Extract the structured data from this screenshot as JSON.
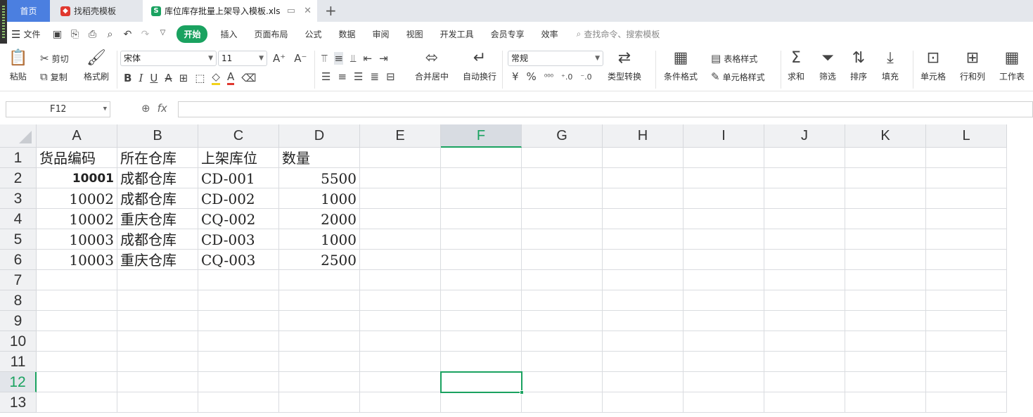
{
  "tabs": {
    "home": "首页",
    "template": "找稻壳模板",
    "file": "库位库存批量上架导入模板.xls"
  },
  "menu": {
    "file_label": "文件",
    "items": [
      "开始",
      "插入",
      "页面布局",
      "公式",
      "数据",
      "审阅",
      "视图",
      "开发工具",
      "会员专享",
      "效率"
    ],
    "search_placeholder": "查找命令、搜索模板"
  },
  "ribbon": {
    "paste": "粘贴",
    "cut": "剪切",
    "copy": "复制",
    "format_painter": "格式刷",
    "font_name": "宋体",
    "font_size": "11",
    "merge_center": "合并居中",
    "wrap_text": "自动换行",
    "number_format": "常规",
    "type_convert": "类型转换",
    "cond_format": "条件格式",
    "table_style": "表格样式",
    "cell_style": "单元格样式",
    "sum": "求和",
    "filter": "筛选",
    "sort": "排序",
    "fill": "填充",
    "cell": "单元格",
    "row_col": "行和列",
    "worksheet": "工作表",
    "currency_symbol": "¥",
    "percent_symbol": "%"
  },
  "formula_bar": {
    "cell_ref": "F12",
    "fx": "fx",
    "content": ""
  },
  "sheet": {
    "columns": [
      "A",
      "B",
      "C",
      "D",
      "E",
      "F",
      "G",
      "H",
      "I",
      "J",
      "K",
      "L"
    ],
    "rows": [
      "1",
      "2",
      "3",
      "4",
      "5",
      "6",
      "7",
      "8",
      "9",
      "10",
      "11",
      "12",
      "13"
    ],
    "selected_cell": "F12",
    "data": [
      [
        "货品编码",
        "所在仓库",
        "上架库位",
        "数量"
      ],
      [
        "10001",
        "成都仓库",
        "CD-001",
        "5500"
      ],
      [
        "10002",
        "成都仓库",
        "CD-002",
        "1000"
      ],
      [
        "10002",
        "重庆仓库",
        "CQ-002",
        "2000"
      ],
      [
        "10003",
        "成都仓库",
        "CD-003",
        "1000"
      ],
      [
        "10003",
        "重庆仓库",
        "CQ-003",
        "2500"
      ]
    ]
  },
  "colors": {
    "accent": "#1aa260",
    "home_tab": "#4b7fe0"
  }
}
